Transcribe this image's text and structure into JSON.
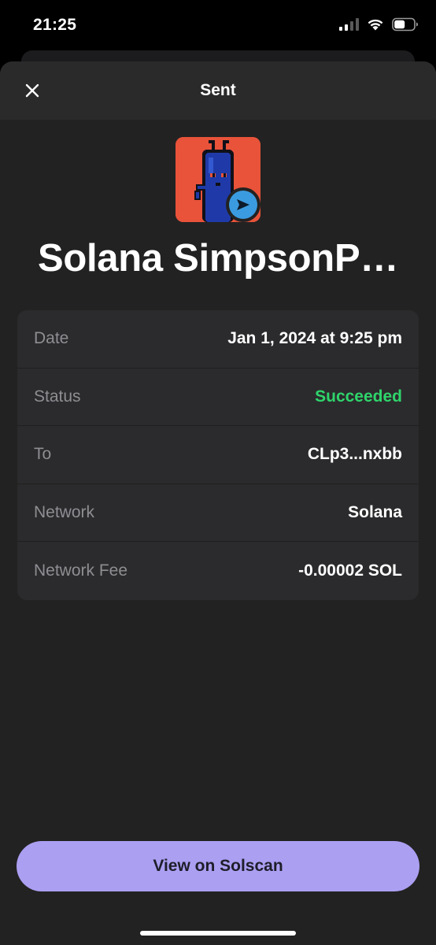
{
  "status_bar": {
    "time": "21:25",
    "icons": [
      "cellular-signal-icon",
      "wifi-icon",
      "battery-icon"
    ],
    "battery_level": 0.55
  },
  "sheet": {
    "title": "Sent",
    "close_icon": "close-icon"
  },
  "asset": {
    "name": "Solana SimpsonP…",
    "image": "pixel-art-nft",
    "badge_icon": "send-icon",
    "badge_color": "#3b9be0",
    "image_bg": "#e8533a"
  },
  "details": [
    {
      "label": "Date",
      "value": "Jan 1, 2024 at 9:25 pm"
    },
    {
      "label": "Status",
      "value": "Succeeded",
      "status": "success"
    },
    {
      "label": "To",
      "value": "CLp3...nxbb"
    },
    {
      "label": "Network",
      "value": "Solana"
    },
    {
      "label": "Network Fee",
      "value": "-0.00002 SOL"
    }
  ],
  "colors": {
    "accent": "#ab9ff2",
    "success": "#2fd46b",
    "background": "#222222",
    "card": "#2b2b2d",
    "muted_text": "#8e8e93"
  },
  "actions": {
    "solscan_label": "View on Solscan"
  }
}
